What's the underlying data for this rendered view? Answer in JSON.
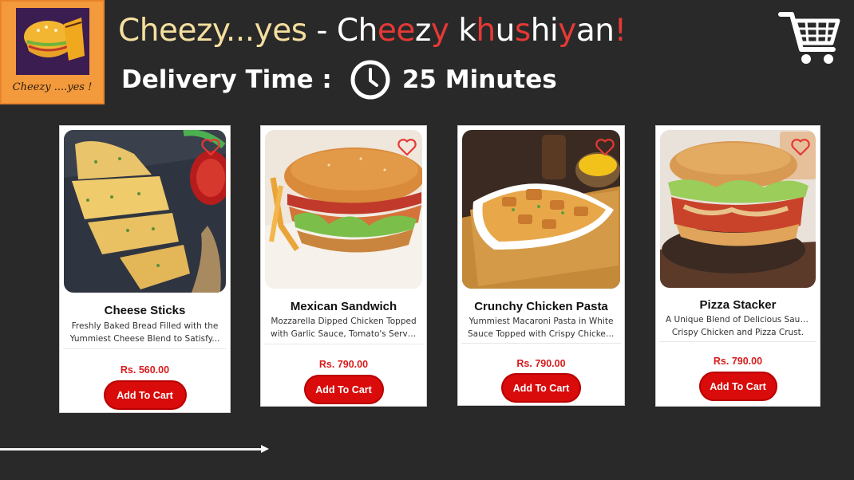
{
  "logo": {
    "tagline": "Cheezy ....yes !"
  },
  "header": {
    "headline_part1": "Cheezy...yes",
    "headline_dash": " - ",
    "brand_letters": [
      "C",
      "h",
      "e",
      "e",
      "z",
      "y",
      " ",
      "k",
      "h",
      "u",
      "s",
      "h",
      "i",
      "y",
      "a",
      "n",
      "!"
    ],
    "delivery_label": "Delivery Time :",
    "delivery_value": "25 Minutes"
  },
  "cart": {
    "icon": "cart-icon"
  },
  "slider": {
    "progress": 0.31
  },
  "colors": {
    "accent": "#d90b0b",
    "background": "#292929",
    "headline_yellow": "#f5df9f"
  },
  "products": [
    {
      "name": "Cheese Sticks",
      "desc_line1": "Freshly Baked Bread Filled with the",
      "desc_line2": "Yummiest Cheese Blend to Satisfy...",
      "price": "Rs. 560.00",
      "button": "Add To Cart"
    },
    {
      "name": "Mexican Sandwich",
      "desc_line1": "Mozzarella Dipped Chicken Topped",
      "desc_line2": "with Garlic Sauce, Tomato's Served in...",
      "price": "Rs. 790.00",
      "button": "Add To Cart"
    },
    {
      "name": "Crunchy Chicken Pasta",
      "desc_line1": "Yummiest Macaroni Pasta in White",
      "desc_line2": "Sauce Topped with Crispy Chicken &...",
      "price": "Rs. 790.00",
      "button": "Add To Cart"
    },
    {
      "name": "Pizza Stacker",
      "desc_line1": "A Unique Blend of Delicious Sauce,",
      "desc_line2": "Crispy Chicken and Pizza Crust.",
      "price": "Rs. 790.00",
      "button": "Add To Cart"
    }
  ]
}
